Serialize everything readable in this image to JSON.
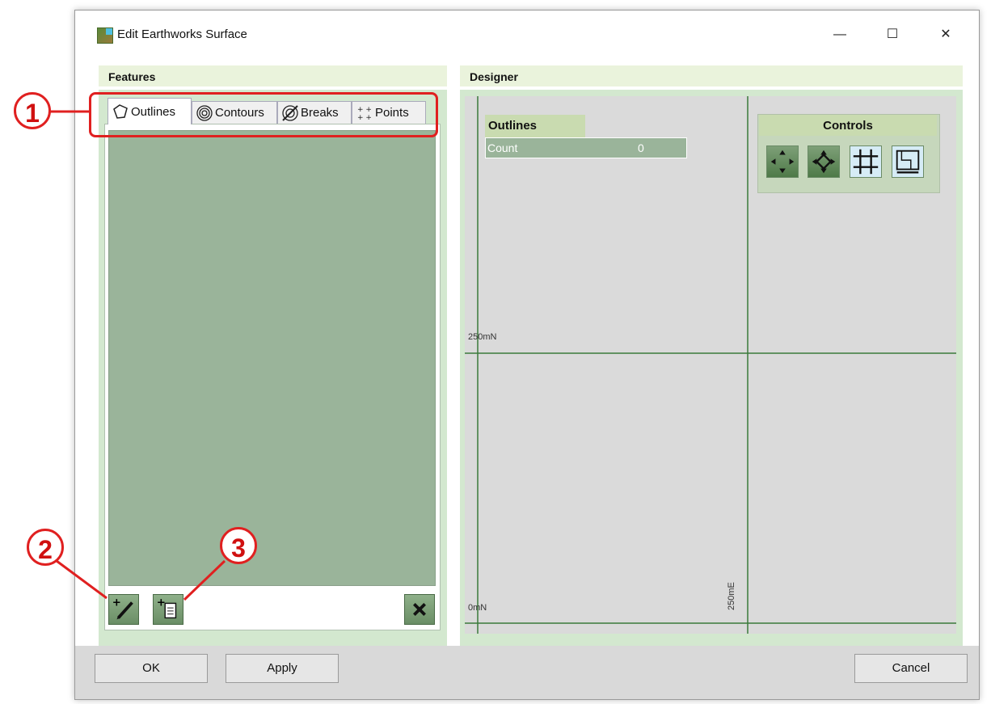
{
  "window": {
    "title": "Edit Earthworks Surface",
    "minimize_glyph": "—",
    "maximize_glyph": "☐",
    "close_glyph": "✕"
  },
  "features": {
    "header": "Features",
    "tabs": [
      {
        "label": "Outlines",
        "icon": "outline-polygon-icon",
        "active": true
      },
      {
        "label": "Contours",
        "icon": "contours-icon",
        "active": false
      },
      {
        "label": "Breaks",
        "icon": "breaks-icon",
        "active": false
      },
      {
        "label": "Points",
        "icon": "points-icon",
        "active": false
      }
    ],
    "buttons": {
      "draw": "draw-new-icon",
      "import": "import-file-icon",
      "delete": "delete-icon"
    }
  },
  "designer": {
    "header": "Designer",
    "info": {
      "title": "Outlines",
      "count_label": "Count",
      "count_value": "0"
    },
    "controls": {
      "title": "Controls",
      "buttons": [
        "pan-icon",
        "rotate-icon",
        "grid-icon",
        "plan-view-icon"
      ]
    },
    "axis": {
      "north_mid": "250mN",
      "north_origin": "0mN",
      "east_mid": "250mE"
    }
  },
  "dialog_buttons": {
    "ok": "OK",
    "apply": "Apply",
    "cancel": "Cancel"
  },
  "callouts": [
    "1",
    "2",
    "3"
  ],
  "colors": {
    "panel_bg": "#d3e8cf",
    "list_bg": "#9ab49a",
    "axis_line": "#3a7a3a",
    "callout": "#e02020"
  }
}
